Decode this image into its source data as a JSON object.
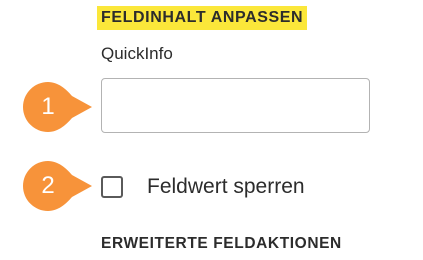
{
  "section": {
    "heading": "FELDINHALT ANPASSEN",
    "highlight_color": "#fbe73a"
  },
  "quickinfo": {
    "label": "QuickInfo",
    "value": ""
  },
  "lock": {
    "label": "Feldwert sperren",
    "checked": false
  },
  "callouts": [
    {
      "number": "1",
      "color": "#f7933a"
    },
    {
      "number": "2",
      "color": "#f7933a"
    }
  ],
  "advanced": {
    "heading": "ERWEITERTE FELDAKTIONEN"
  }
}
